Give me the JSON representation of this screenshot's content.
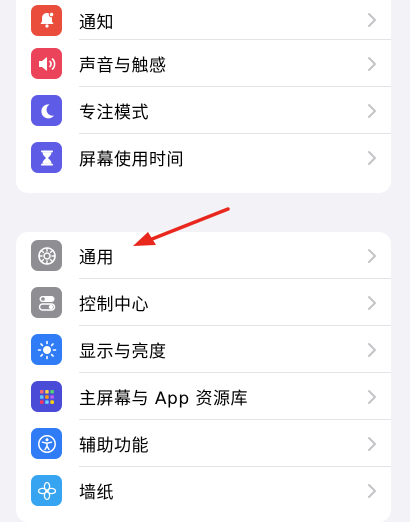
{
  "groups": [
    {
      "items": [
        {
          "label": "通知",
          "icon": "bell-icon",
          "color": "#eb4d3d"
        },
        {
          "label": "声音与触感",
          "icon": "speaker-icon",
          "color": "#eb445a"
        },
        {
          "label": "专注模式",
          "icon": "moon-icon",
          "color": "#5e5ce6"
        },
        {
          "label": "屏幕使用时间",
          "icon": "hourglass-icon",
          "color": "#5e5ce6"
        }
      ]
    },
    {
      "items": [
        {
          "label": "通用",
          "icon": "gear-icon",
          "color": "#8e8e93"
        },
        {
          "label": "控制中心",
          "icon": "toggles-icon",
          "color": "#8e8e93"
        },
        {
          "label": "显示与亮度",
          "icon": "sun-icon",
          "color": "#2f7cf6"
        },
        {
          "label": "主屏幕与 App 资源库",
          "icon": "home-grid-icon",
          "color": "#4a4bd6"
        },
        {
          "label": "辅助功能",
          "icon": "accessibility-icon",
          "color": "#2f7cf6"
        },
        {
          "label": "墙纸",
          "icon": "flower-icon",
          "color": "#36a4f0"
        }
      ]
    }
  ],
  "annotation": {
    "color": "#e8271d",
    "target": "通用"
  }
}
